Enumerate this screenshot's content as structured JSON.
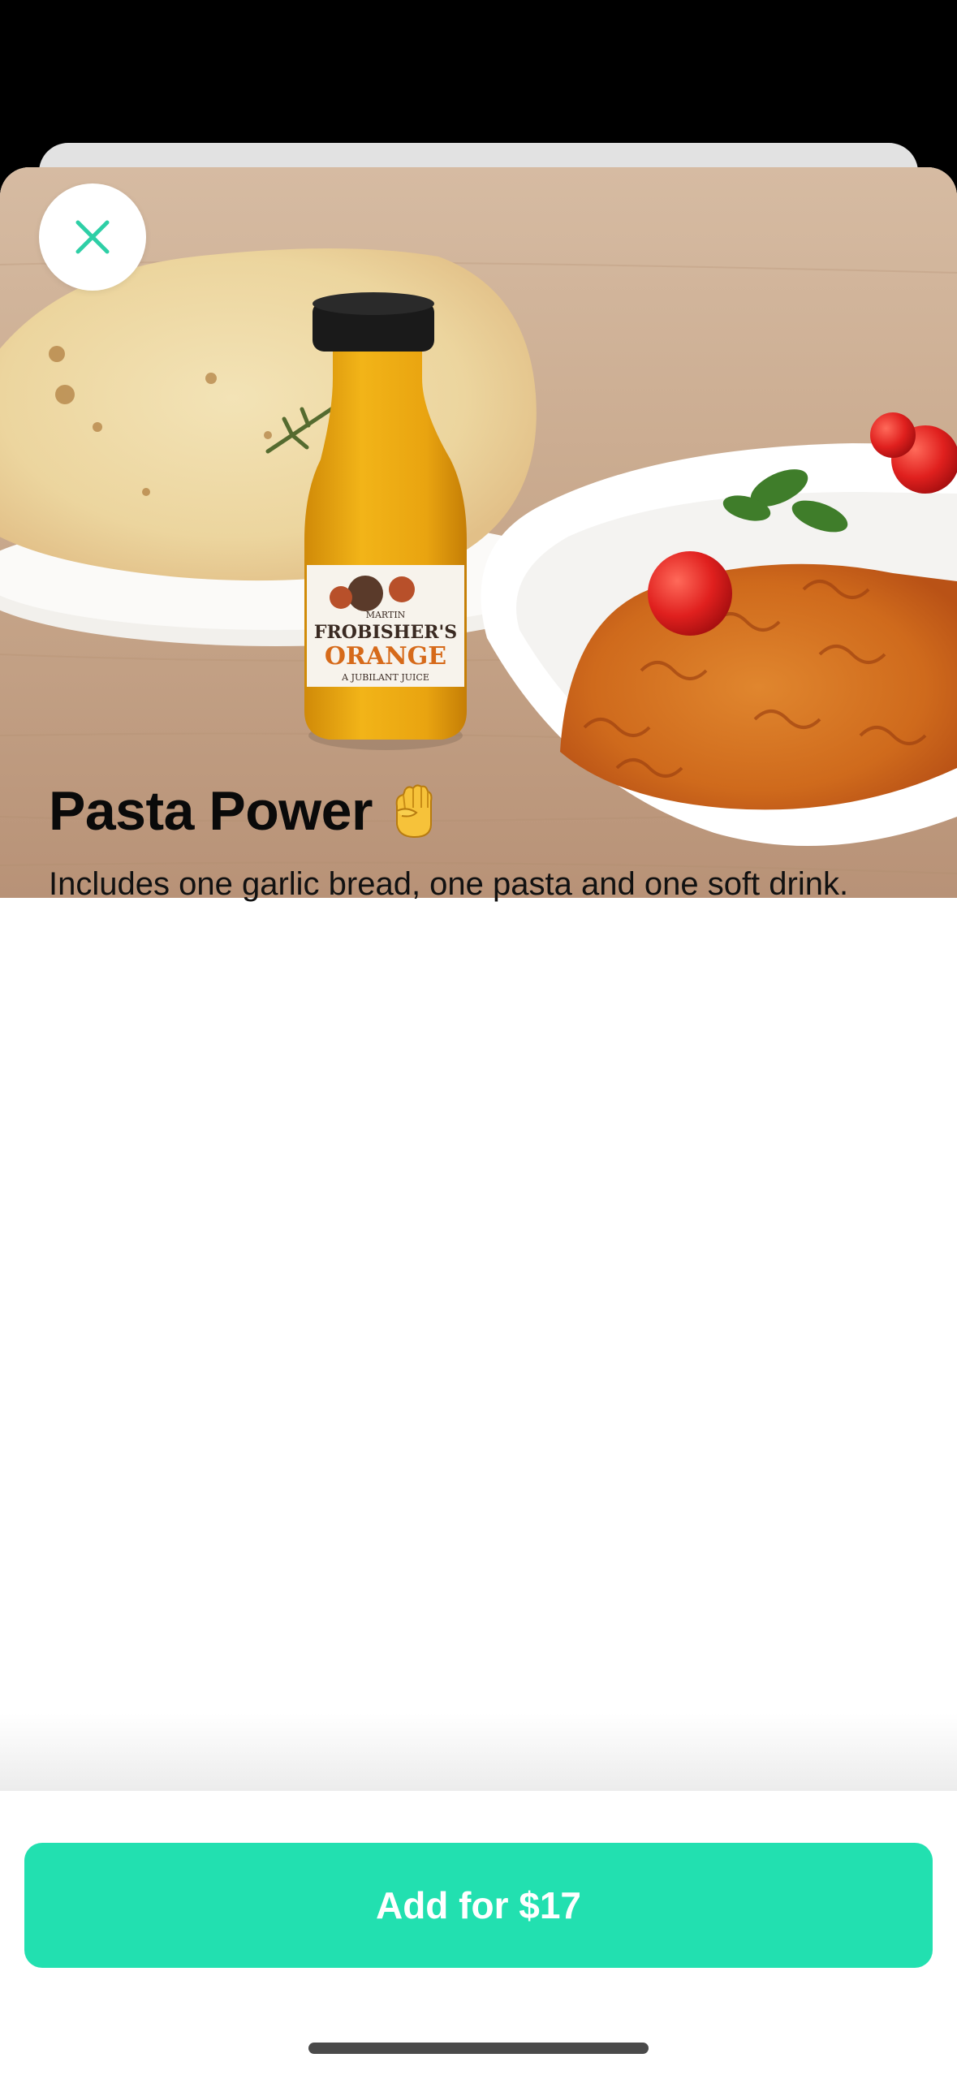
{
  "item": {
    "title": "Pasta Power",
    "title_icon": "raised-fist-icon",
    "description": "Includes one garlic bread, one pasta and one soft drink.",
    "image_alt": "Garlic bread, orange juice bottle and pasta"
  },
  "bottle": {
    "brand_small": "MARTIN",
    "brand": "FROBISHER'S",
    "flavor": "ORANGE",
    "tagline": "A JUBILANT JUICE"
  },
  "actions": {
    "close_icon": "close-icon",
    "add_button_label": "Add for $17"
  },
  "colors": {
    "accent": "#22e0b0",
    "close_icon": "#2ecfa6",
    "background": "#ffffff"
  }
}
